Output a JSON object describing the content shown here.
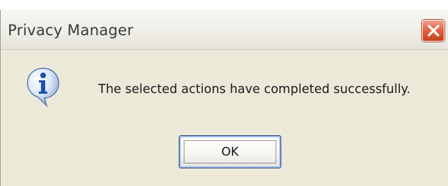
{
  "window": {
    "title": "Privacy Manager"
  },
  "dialog": {
    "icon": "info-icon",
    "message": "The selected actions have completed successfully.",
    "ok_label": "OK"
  },
  "colors": {
    "dialog_background": "#ece9d8",
    "close_button": "#e2613f",
    "ok_button_border": "#1f3f78"
  }
}
